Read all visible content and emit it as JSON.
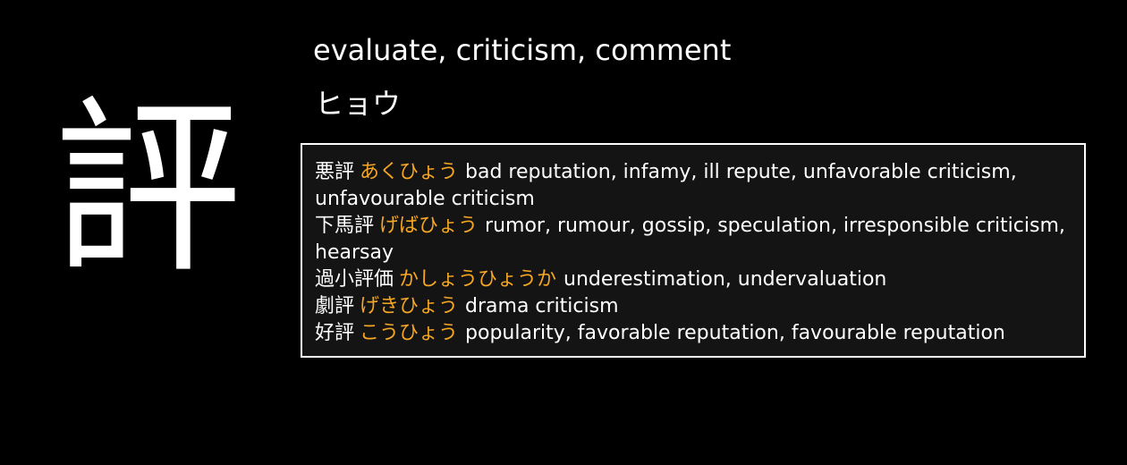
{
  "kanji": {
    "character": "評",
    "meaning": "evaluate, criticism, comment",
    "reading": "ヒョウ"
  },
  "vocabulary": [
    {
      "word": "悪評",
      "kana": "あくひょう",
      "gloss": "bad reputation, infamy, ill repute, unfavorable criticism, unfavourable criticism"
    },
    {
      "word": "下馬評",
      "kana": "げばひょう",
      "gloss": "rumor, rumour, gossip, speculation, irresponsible criticism, hearsay"
    },
    {
      "word": "過小評価",
      "kana": "かしょうひょうか",
      "gloss": "underestimation, undervaluation"
    },
    {
      "word": "劇評",
      "kana": "げきひょう",
      "gloss": "drama criticism"
    },
    {
      "word": "好評",
      "kana": "こうひょう",
      "gloss": "popularity, favorable reputation, favourable reputation"
    }
  ],
  "colors": {
    "background": "#000000",
    "text": "#ffffff",
    "kana_accent": "#f5a623",
    "box_background": "#141414",
    "box_border": "#ffffff"
  }
}
